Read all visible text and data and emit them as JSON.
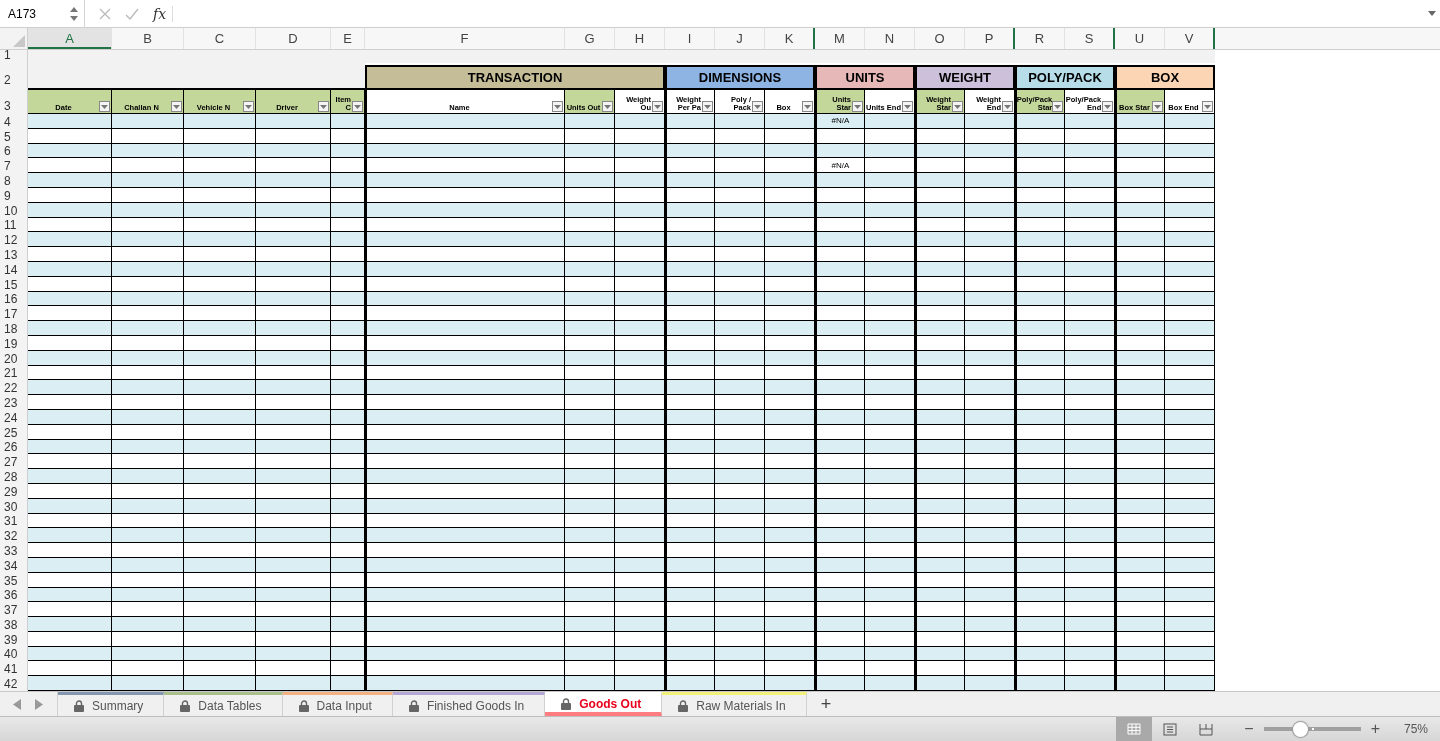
{
  "formula_bar": {
    "name_box": "A173",
    "function_label": "fx"
  },
  "sheet": {
    "header_row_numbers": [
      "1",
      "2",
      "3"
    ],
    "sections": [
      {
        "columns": [
          {
            "letter": "A",
            "selected": true,
            "hidden_after": false,
            "header": "Date",
            "shaded": true
          },
          {
            "letter": "B",
            "selected": false,
            "hidden_after": false,
            "header": "Challan N",
            "shaded": true
          },
          {
            "letter": "C",
            "selected": false,
            "hidden_after": false,
            "header": "Vehicle N",
            "shaded": true
          },
          {
            "letter": "D",
            "selected": false,
            "hidden_after": false,
            "header": "Driver",
            "shaded": true
          },
          {
            "letter": "E",
            "selected": false,
            "hidden_after": false,
            "header": "Item C",
            "shaded": true
          }
        ]
      },
      {
        "title": "TRANSACTION",
        "color": "#c4bd97",
        "columns": [
          {
            "letter": "F",
            "selected": false,
            "hidden_after": false,
            "header": "Name",
            "shaded": false
          },
          {
            "letter": "G",
            "selected": false,
            "hidden_after": false,
            "header": "Units Out",
            "shaded": true
          },
          {
            "letter": "H",
            "selected": false,
            "hidden_after": false,
            "header": "Weight Ou",
            "shaded": false
          }
        ]
      },
      {
        "title": "DIMENSIONS",
        "color": "#8db4e2",
        "columns": [
          {
            "letter": "I",
            "selected": false,
            "hidden_after": false,
            "header": "Weight Per Pa",
            "shaded": false
          },
          {
            "letter": "J",
            "selected": false,
            "hidden_after": false,
            "header": "Poly / Pack",
            "shaded": false
          },
          {
            "letter": "K",
            "selected": false,
            "hidden_after": true,
            "header": "Box",
            "shaded": false
          }
        ]
      },
      {
        "title": "UNITS",
        "color": "#e6b8b7",
        "columns": [
          {
            "letter": "M",
            "selected": false,
            "hidden_after": false,
            "header": "Units Star",
            "shaded": true
          },
          {
            "letter": "N",
            "selected": false,
            "hidden_after": false,
            "header": "Units End",
            "shaded": false
          }
        ]
      },
      {
        "title": "WEIGHT",
        "color": "#ccc0da",
        "columns": [
          {
            "letter": "O",
            "selected": false,
            "hidden_after": false,
            "header": "Weight Star",
            "shaded": true
          },
          {
            "letter": "P",
            "selected": false,
            "hidden_after": true,
            "header": "Weight End",
            "shaded": false
          }
        ]
      },
      {
        "title": "POLY/PACK",
        "color": "#b7dee8",
        "columns": [
          {
            "letter": "R",
            "selected": false,
            "hidden_after": false,
            "header": "Poly/Pack Star",
            "shaded": true
          },
          {
            "letter": "S",
            "selected": false,
            "hidden_after": true,
            "header": "Poly/Pack End",
            "shaded": false
          }
        ]
      },
      {
        "title": "BOX",
        "color": "#fcd5b4",
        "columns": [
          {
            "letter": "U",
            "selected": false,
            "hidden_after": false,
            "header": "Box Star",
            "shaded": true
          },
          {
            "letter": "V",
            "selected": false,
            "hidden_after": true,
            "header": "Box End",
            "shaded": false
          }
        ]
      }
    ],
    "rows": [
      {
        "number": "4",
        "shaded": true,
        "cells": [
          {},
          {},
          {},
          {},
          {},
          {},
          {},
          {},
          {},
          {},
          {},
          {
            "text": "#N/A"
          }
        ]
      },
      {
        "number": "5",
        "shaded": false
      },
      {
        "number": "6",
        "shaded": true
      },
      {
        "number": "7",
        "shaded": false,
        "cells": [
          {},
          {},
          {},
          {},
          {},
          {},
          {},
          {},
          {},
          {},
          {},
          {
            "text": "#N/A"
          }
        ]
      },
      {
        "number": "8",
        "shaded": true
      },
      {
        "number": "9",
        "shaded": false
      },
      {
        "number": "10",
        "shaded": true
      },
      {
        "number": "11",
        "shaded": false
      },
      {
        "number": "12",
        "shaded": true
      },
      {
        "number": "13",
        "shaded": false
      },
      {
        "number": "14",
        "shaded": true
      },
      {
        "number": "15",
        "shaded": false
      },
      {
        "number": "16",
        "shaded": true
      },
      {
        "number": "17",
        "shaded": false
      },
      {
        "number": "18",
        "shaded": true
      },
      {
        "number": "19",
        "shaded": false
      },
      {
        "number": "20",
        "shaded": true
      },
      {
        "number": "21",
        "shaded": false
      },
      {
        "number": "22",
        "shaded": true
      },
      {
        "number": "23",
        "shaded": false
      },
      {
        "number": "24",
        "shaded": true
      },
      {
        "number": "25",
        "shaded": false
      },
      {
        "number": "26",
        "shaded": true
      },
      {
        "number": "27",
        "shaded": false
      },
      {
        "number": "28",
        "shaded": true
      },
      {
        "number": "29",
        "shaded": false
      },
      {
        "number": "30",
        "shaded": true
      },
      {
        "number": "31",
        "shaded": false
      },
      {
        "number": "32",
        "shaded": true
      },
      {
        "number": "33",
        "shaded": false
      },
      {
        "number": "34",
        "shaded": true
      },
      {
        "number": "35",
        "shaded": false
      },
      {
        "number": "36",
        "shaded": true
      },
      {
        "number": "37",
        "shaded": false
      },
      {
        "number": "38",
        "shaded": true
      },
      {
        "number": "39",
        "shaded": false
      },
      {
        "number": "40",
        "shaded": true
      },
      {
        "number": "41",
        "shaded": false
      },
      {
        "number": "42",
        "shaded": true
      }
    ]
  },
  "sheet_tabs": [
    {
      "label": "Summary",
      "color": "#8497b0",
      "locked": true,
      "selected": false
    },
    {
      "label": "Data Tables",
      "color": "#a9c08d",
      "locked": true,
      "selected": false
    },
    {
      "label": "Data Input",
      "color": "#f4b183",
      "locked": true,
      "selected": false
    },
    {
      "label": "Finished Goods In",
      "color": "#b4a7d6",
      "locked": true,
      "selected": false
    },
    {
      "label": "Goods Out",
      "color": "#ff7c80",
      "locked": true,
      "selected": true
    },
    {
      "label": "Raw Materials In",
      "color": "#f2f27a",
      "locked": true,
      "selected": false
    }
  ],
  "add_sheet": "+",
  "status_bar": {
    "views": [
      {
        "kind": "normal",
        "selected": true
      },
      {
        "kind": "page_layout",
        "selected": false
      },
      {
        "kind": "page_break",
        "selected": false
      }
    ],
    "zoom": {
      "minus": "−",
      "plus": "+",
      "level": 0.37,
      "reading": "75%"
    }
  }
}
